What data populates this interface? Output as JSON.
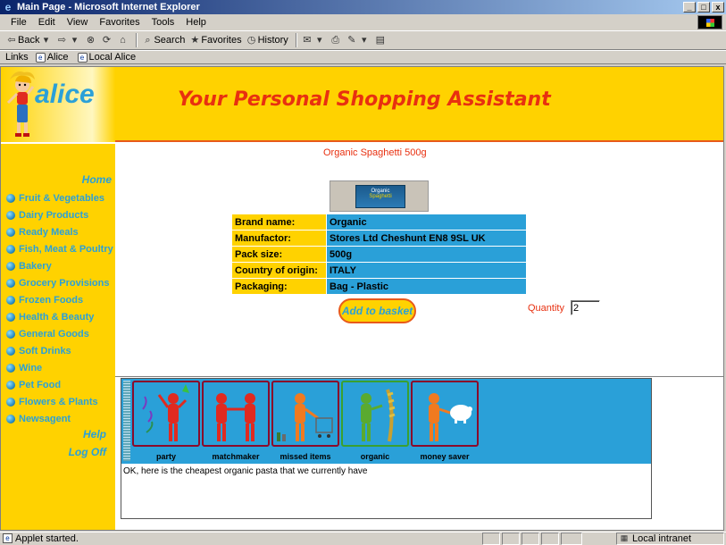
{
  "window": {
    "title": "Main Page - Microsoft Internet Explorer",
    "min": "_",
    "max": "□",
    "close": "x"
  },
  "menu": [
    "File",
    "Edit",
    "View",
    "Favorites",
    "Tools",
    "Help"
  ],
  "toolbar": {
    "back": "Back",
    "search": "Search",
    "favorites": "Favorites",
    "history": "History"
  },
  "links": {
    "label": "Links",
    "items": [
      "Alice",
      "Local Alice"
    ]
  },
  "header": {
    "logo": "alice",
    "tagline": "Your Personal Shopping Assistant"
  },
  "sidebar": {
    "home": "Home",
    "categories": [
      "Fruit & Vegetables",
      "Dairy Products",
      "Ready Meals",
      "Fish, Meat & Poultry",
      "Bakery",
      "Grocery Provisions",
      "Frozen Foods",
      "Health & Beauty",
      "General Goods",
      "Soft Drinks",
      "Wine",
      "Pet Food",
      "Flowers & Plants",
      "Newsagent"
    ],
    "help": "Help",
    "logoff": "Log Off"
  },
  "product": {
    "title": "Organic Spaghetti 500g",
    "image_label_1": "Organic",
    "image_label_2": "Spaghetti",
    "details": [
      {
        "label": "Brand name:",
        "value": "Organic"
      },
      {
        "label": "Manufactor:",
        "value": "Stores Ltd Cheshunt EN8 9SL UK"
      },
      {
        "label": "Pack size:",
        "value": "500g"
      },
      {
        "label": "Country of origin:",
        "value": "ITALY"
      },
      {
        "label": "Packaging:",
        "value": "Bag - Plastic"
      }
    ],
    "add_button": "Add to basket",
    "quantity_label": "Quantity",
    "quantity_value": "2"
  },
  "agents": {
    "items": [
      {
        "caption": "party",
        "icon": "party-agent-icon",
        "color": "#e02a20"
      },
      {
        "caption": "matchmaker",
        "icon": "matchmaker-agent-icon",
        "color": "#e02a20"
      },
      {
        "caption": "missed items",
        "icon": "missed-items-agent-icon",
        "color": "#f07a20"
      },
      {
        "caption": "organic",
        "icon": "organic-agent-icon",
        "color": "#5aaa30"
      },
      {
        "caption": "money saver",
        "icon": "money-saver-agent-icon",
        "color": "#f07a20"
      }
    ],
    "message": "OK, here is the cheapest organic pasta that we currently have"
  },
  "status": {
    "text": "Applet started.",
    "zone": "Local intranet"
  }
}
